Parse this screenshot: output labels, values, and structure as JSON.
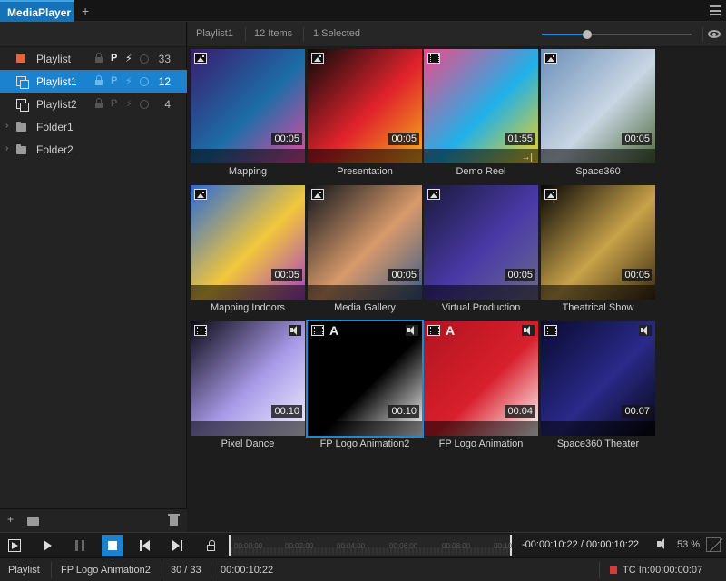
{
  "window": {
    "tab_title": "MediaPlayer",
    "add_tab": "+"
  },
  "sidebar": {
    "items": [
      {
        "label": "Playlist",
        "count": "33",
        "attr_p": "P"
      },
      {
        "label": "Playlist1",
        "count": "12",
        "attr_p": "P"
      },
      {
        "label": "Playlist2",
        "count": "4",
        "attr_p": "P"
      },
      {
        "label": "Folder1"
      },
      {
        "label": "Folder2"
      }
    ],
    "footer": {
      "add": "+"
    }
  },
  "header": {
    "playlist_name": "Playlist1",
    "items_count": "12 Items",
    "selected_count": "1 Selected",
    "zoom_level": 0.3
  },
  "media": [
    {
      "label": "Mapping",
      "duration": "00:05",
      "type": "image-icon",
      "colors": [
        "#3a1d6e",
        "#1d6ea8",
        "#e84aa0"
      ]
    },
    {
      "label": "Presentation",
      "duration": "00:05",
      "type": "image-icon",
      "colors": [
        "#0a0a0a",
        "#e2232c",
        "#f5b21c"
      ]
    },
    {
      "label": "Demo Reel",
      "duration": "01:55",
      "type": "video-icon",
      "colors": [
        "#f04a8c",
        "#20b0e8",
        "#f5d21c"
      ]
    },
    {
      "label": "Space360",
      "duration": "00:05",
      "type": "image-icon",
      "colors": [
        "#6a8fb8",
        "#c9d6e4",
        "#4d6a3a"
      ]
    },
    {
      "label": "Mapping Indoors",
      "duration": "00:05",
      "type": "image-icon",
      "colors": [
        "#2a6ad8",
        "#f2c73a",
        "#a53cc8"
      ]
    },
    {
      "label": "Media Gallery",
      "duration": "00:05",
      "type": "image-icon",
      "colors": [
        "#10141c",
        "#d89a6a",
        "#3a5a8a"
      ]
    },
    {
      "label": "Virtual Production",
      "duration": "00:05",
      "type": "image-icon",
      "colors": [
        "#1a1a3a",
        "#4a3aa8",
        "#6a6a8a"
      ]
    },
    {
      "label": "Theatrical Show",
      "duration": "00:05",
      "type": "image-icon",
      "colors": [
        "#050505",
        "#c8a24a",
        "#3a2a10"
      ]
    },
    {
      "label": "Pixel Dance",
      "duration": "00:10",
      "type": "video-icon",
      "colors": [
        "#0a0812",
        "#a89ae8",
        "#f0f0ff"
      ]
    },
    {
      "label": "FP Logo Animation2",
      "duration": "00:10",
      "type": "video-icon",
      "alpha": "A",
      "colors": [
        "#000000",
        "#000000",
        "#ffffff"
      ]
    },
    {
      "label": "FP Logo Animation",
      "duration": "00:04",
      "type": "video-icon",
      "alpha": "A",
      "colors": [
        "#b01420",
        "#d8202c",
        "#ffffff"
      ]
    },
    {
      "label": "Space360 Theater",
      "duration": "00:07",
      "type": "video-icon",
      "colors": [
        "#0a0a30",
        "#2a2a8a",
        "#060612"
      ]
    }
  ],
  "transport": {
    "timeline_ticks": [
      "00:00:00",
      "00:02:00",
      "00:04:00",
      "00:06:00",
      "00:08:00",
      "00:10"
    ],
    "timecode": "-00:00:10:22 / 00:00:10:22",
    "volume": "53 %"
  },
  "status": {
    "playlist": "Playlist",
    "clip": "FP Logo Animation2",
    "position": "30 / 33",
    "time": "00:00:10:22",
    "tc_in_label": "TC In:",
    "tc_in_value": "00:00:00:07"
  }
}
